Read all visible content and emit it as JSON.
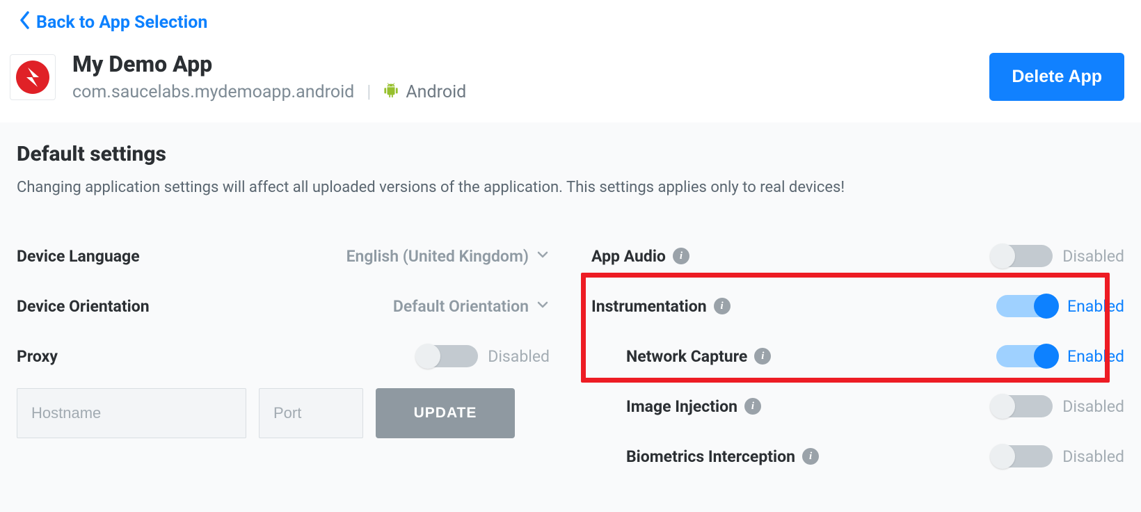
{
  "back_link_label": "Back to App Selection",
  "app": {
    "title": "My Demo App",
    "package": "com.saucelabs.mydemoapp.android",
    "platform": "Android"
  },
  "delete_button_label": "Delete App",
  "settings": {
    "heading": "Default settings",
    "description": "Changing application settings will affect all uploaded versions of the application. This settings applies only to real devices!"
  },
  "left": {
    "device_language": {
      "label": "Device Language",
      "value": "English (United Kingdom)"
    },
    "device_orientation": {
      "label": "Device Orientation",
      "value": "Default Orientation"
    },
    "proxy": {
      "label": "Proxy",
      "enabled": false,
      "state_label": "Disabled"
    },
    "proxy_form": {
      "hostname_placeholder": "Hostname",
      "port_placeholder": "Port",
      "update_label": "UPDATE"
    }
  },
  "right": {
    "app_audio": {
      "label": "App Audio",
      "enabled": false,
      "state_label": "Disabled"
    },
    "instrumentation": {
      "label": "Instrumentation",
      "enabled": true,
      "state_label": "Enabled"
    },
    "network_capture": {
      "label": "Network Capture",
      "enabled": true,
      "state_label": "Enabled"
    },
    "image_injection": {
      "label": "Image Injection",
      "enabled": false,
      "state_label": "Disabled"
    },
    "biometrics_interception": {
      "label": "Biometrics Interception",
      "enabled": false,
      "state_label": "Disabled"
    }
  },
  "icon_glyph": "i"
}
